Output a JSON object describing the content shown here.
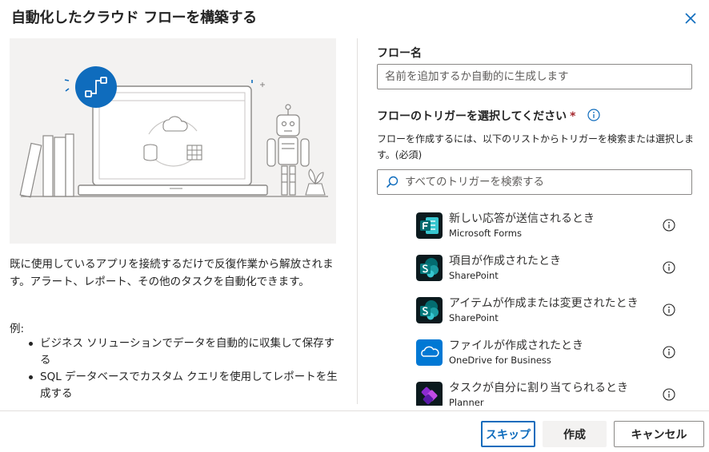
{
  "dialog": {
    "title": "自動化したクラウド フローを構築する",
    "close_icon": "close-icon"
  },
  "left": {
    "description": "既に使用しているアプリを接続するだけで反復作業から解放されます。アラート、レポート、その他のタスクを自動化できます。",
    "examples_label": "例:",
    "examples": [
      "ビジネス ソリューションでデータを自動的に収集して保存する",
      "SQL データベースでカスタム クエリを使用してレポートを生成する"
    ]
  },
  "form": {
    "flow_name_label": "フロー名",
    "flow_name_value": "",
    "flow_name_placeholder": "名前を追加するか自動的に生成します",
    "trigger_label": "フローのトリガーを選択してください",
    "required_marker": "*",
    "help_text": "フローを作成するには、以下のリストからトリガーを検索または選択します。(必須)",
    "search_placeholder": "すべてのトリガーを検索する",
    "search_value": ""
  },
  "triggers": [
    {
      "title": "新しい応答が送信されるとき",
      "source": "Microsoft Forms",
      "icon": "forms-icon",
      "color": "#036c70"
    },
    {
      "title": "項目が作成されたとき",
      "source": "SharePoint",
      "icon": "sharepoint-icon",
      "color": "#036c70"
    },
    {
      "title": "アイテムが作成または変更されたとき",
      "source": "SharePoint",
      "icon": "sharepoint-icon",
      "color": "#036c70"
    },
    {
      "title": "ファイルが作成されたとき",
      "source": "OneDrive for Business",
      "icon": "onedrive-icon",
      "color": "#0078d4"
    },
    {
      "title": "タスクが自分に割り当てられるとき",
      "source": "Planner",
      "icon": "planner-icon",
      "color": "#7719aa"
    }
  ],
  "footer": {
    "skip_label": "スキップ",
    "create_label": "作成",
    "cancel_label": "キャンセル"
  },
  "colors": {
    "accent": "#0f6cbd",
    "required": "#a4262c",
    "illustration_bg": "#f3f2f1"
  }
}
